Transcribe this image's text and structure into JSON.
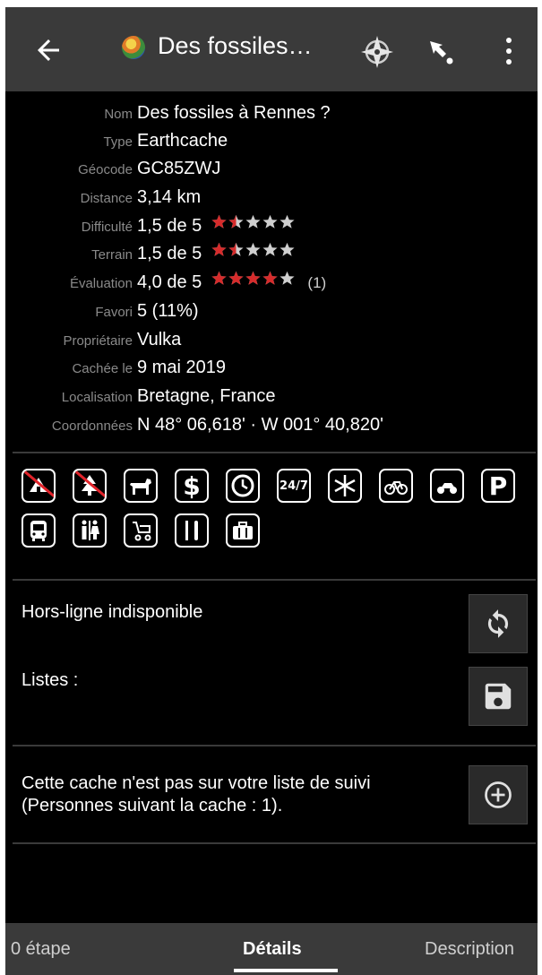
{
  "app_bar": {
    "title": "Des fossiles…",
    "icons": [
      "back-arrow-icon",
      "earthcache-type-icon",
      "compass-icon",
      "navigate-icon",
      "overflow-menu-icon"
    ]
  },
  "details": [
    {
      "label": "Nom",
      "value": "Des fossiles à Rennes ?"
    },
    {
      "label": "Type",
      "value": "Earthcache"
    },
    {
      "label": "Géocode",
      "value": "GC85ZWJ"
    },
    {
      "label": "Distance",
      "value": "3,14 km"
    },
    {
      "label": "Difficulté",
      "value": "1,5 de 5",
      "rating": 1.5
    },
    {
      "label": "Terrain",
      "value": "1,5 de 5",
      "rating": 1.5
    },
    {
      "label": "Évaluation",
      "value": "4,0 de 5",
      "rating": 4.0,
      "votes": "(1)"
    },
    {
      "label": "Favori",
      "value": "5 (11%)"
    },
    {
      "label": "Propriétaire",
      "value": "Vulka"
    },
    {
      "label": "Cachée le",
      "value": "9 mai 2019"
    },
    {
      "label": "Localisation",
      "value": "Bretagne, France"
    },
    {
      "label": "Coordonnées",
      "value": "N 48° 06,618' · W 001° 40,820'"
    }
  ],
  "attributes": {
    "row1": [
      "no-camping-icon",
      "no-christmas-tree-icon",
      "dogs-icon",
      "fee-icon",
      "short-time-icon",
      "always-available-icon",
      "winter-icon",
      "bicycles-icon",
      "motorcycles-icon",
      "parking-icon"
    ],
    "row2": [
      "public-transport-icon",
      "restrooms-icon",
      "stroller-icon",
      "food-icon",
      "tourist-icon"
    ],
    "labels": {
      "always_available": "24/7",
      "fee": "$",
      "parking": "P"
    }
  },
  "offline": {
    "status": "Hors-ligne indisponible",
    "lists_label": "Listes :"
  },
  "watchlist": {
    "text_line1": "Cette cache n'est pas sur votre liste de suivi",
    "text_line2": "(Personnes suivant la cache : 1)."
  },
  "tabs": [
    {
      "label": "0 étape",
      "active": false
    },
    {
      "label": "Détails",
      "active": true
    },
    {
      "label": "Description",
      "active": false
    }
  ],
  "colors": {
    "accent_star": "#d62b2b",
    "appbar": "#3a3a3a",
    "background": "#000000"
  }
}
